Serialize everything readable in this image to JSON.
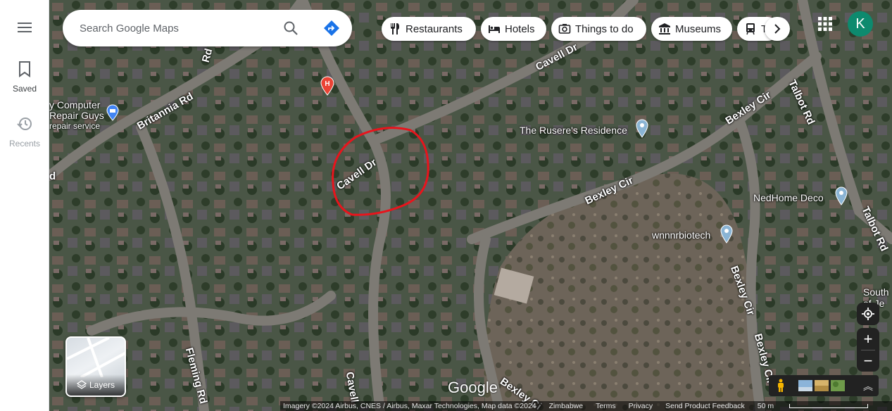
{
  "rail": {
    "saved_label": "Saved",
    "recents_label": "Recents"
  },
  "search": {
    "placeholder": "Search Google Maps"
  },
  "chips": [
    {
      "label": "Restaurants",
      "icon": "fork-knife-icon"
    },
    {
      "label": "Hotels",
      "icon": "bed-icon"
    },
    {
      "label": "Things to do",
      "icon": "camera-icon"
    },
    {
      "label": "Museums",
      "icon": "museum-icon"
    },
    {
      "label": "T",
      "icon": "transit-icon"
    }
  ],
  "account": {
    "initial": "K",
    "color": "#0d8a6e"
  },
  "places": {
    "computer_repair_line1": "y Computer",
    "computer_repair_line2": "Repair Guys",
    "computer_repair_sub": "repair service",
    "rusere": "The Rusere's Residence",
    "nedhome": "NedHome Deco",
    "wnnnr": "wnnnrbiotech",
    "south_line1": "South",
    "south_line2": "of Je"
  },
  "roads": {
    "britannia": "Britannia Rd",
    "cavell_top": "Cavell Dr",
    "cavell_circled": "Cavell Dr",
    "cavell_bottom": "Cavell",
    "rd_top_left": "Rd",
    "d_left": "d",
    "bexley_top": "Bexley Cir",
    "bexley_mid": "Bexley Cir",
    "bexley_right": "Bexley Cir",
    "bexley_right2": "Bexley Cir",
    "bexley_bottom": "Bexley Ci",
    "talbot_top": "Talbot Rd",
    "talbot_right": "Talbot Rd",
    "fleming": "Fleming Rd"
  },
  "layers_label": "Layers",
  "google_logo": "Google",
  "footer": {
    "imagery": "Imagery ©2024 Airbus, CNES / Airbus, Maxar Technologies, Map data ©2024",
    "country": "Zimbabwe",
    "terms": "Terms",
    "privacy": "Privacy",
    "feedback": "Send Product Feedback",
    "scale": "50 m"
  },
  "colors": {
    "annotation_circle": "#e8141c",
    "hospital_pin": "#ea4335",
    "place_pin": "#8ab4d4",
    "repair_pin": "#4285f4"
  }
}
